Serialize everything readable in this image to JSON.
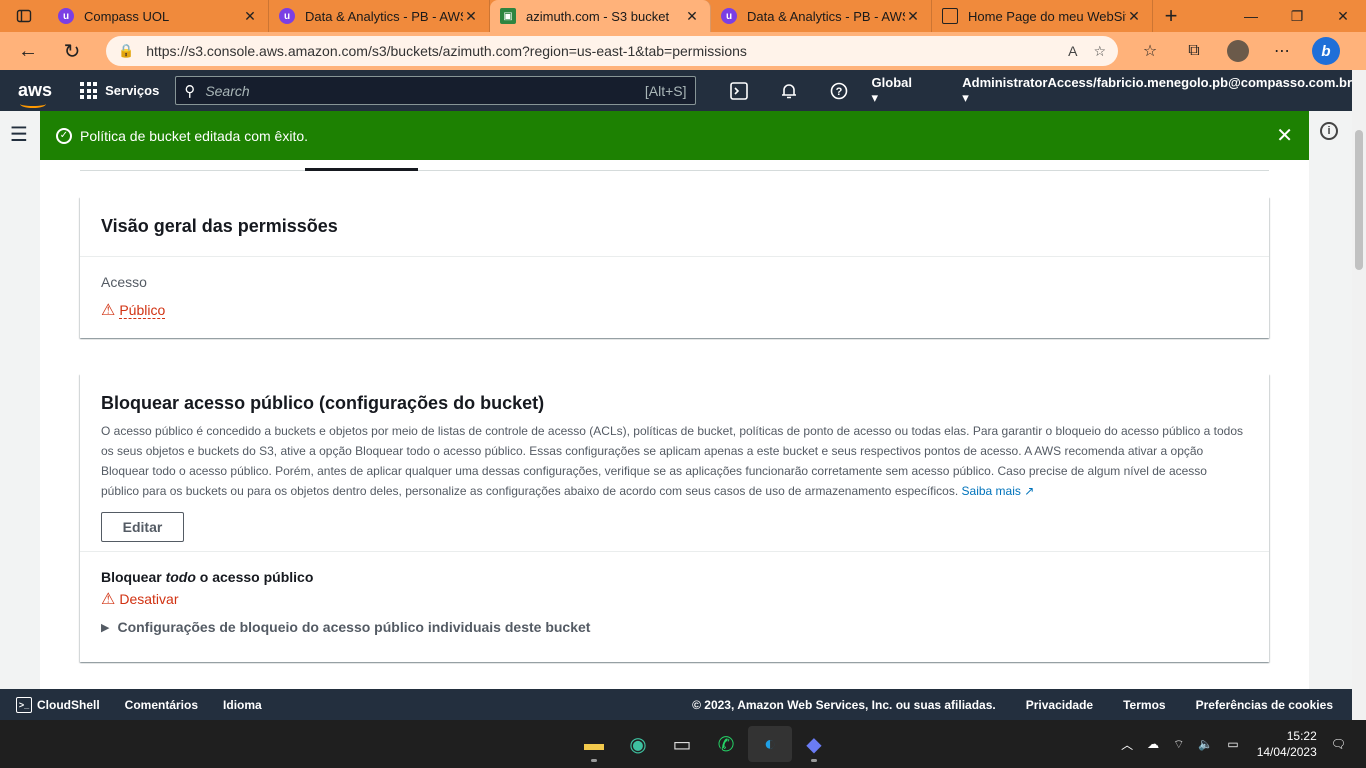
{
  "browser": {
    "tabs": [
      {
        "title": "Compass UOL",
        "favicon": "u"
      },
      {
        "title": "Data & Analytics - PB - AWS",
        "favicon": "u"
      },
      {
        "title": "azimuth.com - S3 bucket",
        "favicon": "s3",
        "active": true
      },
      {
        "title": "Data & Analytics - PB - AWS",
        "favicon": "u"
      },
      {
        "title": "Home Page do meu WebSite",
        "favicon": "page"
      }
    ],
    "url": "https://s3.console.aws.amazon.com/s3/buckets/azimuth.com?region=us-east-1&tab=permissions"
  },
  "aws_nav": {
    "logo": "aws",
    "services_label": "Serviços",
    "search_placeholder": "Search",
    "search_shortcut": "[Alt+S]",
    "region": "Global",
    "account": "AdministratorAccess/fabricio.menegolo.pb@compasso.com.br"
  },
  "flash": {
    "message": "Política de bucket editada com êxito."
  },
  "permissions_overview": {
    "title": "Visão geral das permissões",
    "access_label": "Acesso",
    "access_value": "Público"
  },
  "block_public_access": {
    "title": "Bloquear acesso público (configurações do bucket)",
    "description": "O acesso público é concedido a buckets e objetos por meio de listas de controle de acesso (ACLs), políticas de bucket, políticas de ponto de acesso ou todas elas. Para garantir o bloqueio do acesso público a todos os seus objetos e buckets do S3, ative a opção Bloquear todo o acesso público. Essas configurações se aplicam apenas a este bucket e seus respectivos pontos de acesso. A AWS recomenda ativar a opção Bloquear todo o acesso público. Porém, antes de aplicar qualquer uma dessas configurações, verifique se as aplicações funcionarão corretamente sem acesso público. Caso precise de algum nível de acesso público para os buckets ou para os objetos dentro deles, personalize as configurações abaixo de acordo com seus casos de uso de armazenamento específicos.",
    "learn_more": "Saiba mais",
    "edit_button": "Editar",
    "block_all_pre": "Bloquear ",
    "block_all_em": "todo",
    "block_all_post": " o acesso público",
    "block_all_status": "Desativar",
    "expander_label": "Configurações de bloqueio do acesso público individuais deste bucket"
  },
  "footer": {
    "cloudshell": "CloudShell",
    "feedback": "Comentários",
    "language": "Idioma",
    "copyright": "© 2023, Amazon Web Services, Inc. ou suas afiliadas.",
    "privacy": "Privacidade",
    "terms": "Termos",
    "cookies": "Preferências de cookies"
  },
  "taskbar": {
    "time": "15:22",
    "date": "14/04/2023"
  },
  "colors": {
    "aws_nav": "#232f3e",
    "success": "#1d8102",
    "warning": "#d13212",
    "link": "#0073bb",
    "browser_tabstrip": "#f08a3c"
  }
}
